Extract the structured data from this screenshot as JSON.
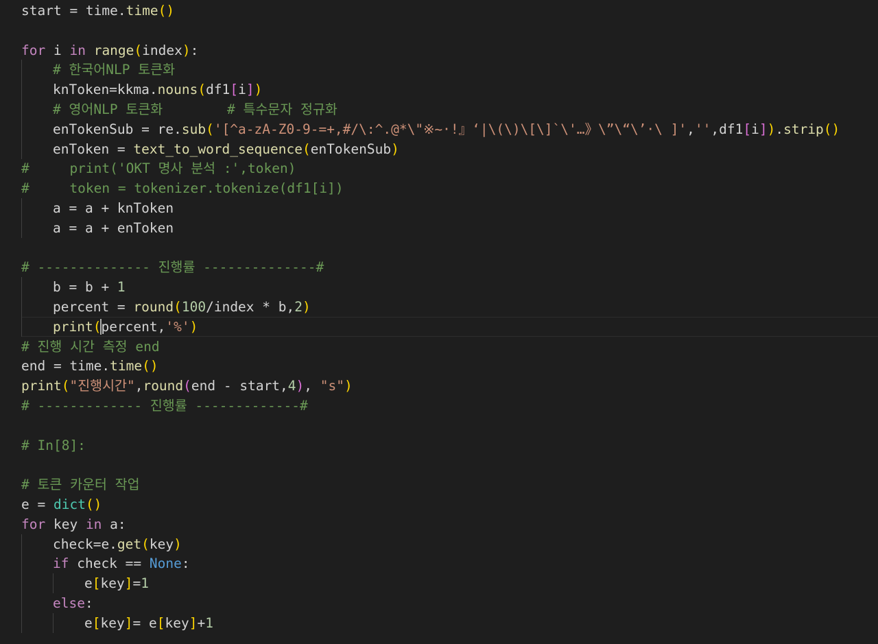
{
  "editor": {
    "theme_colors": {
      "background": "#1e1e1e",
      "keyword": "#c586c0",
      "function": "#dcdcaa",
      "string": "#ce9178",
      "number": "#b5cea8",
      "comment": "#6a9955",
      "class": "#4ec9b0",
      "constant": "#569cd6",
      "bracket_level1": "#ffd700",
      "bracket_level2": "#da70d6"
    },
    "lines": [
      {
        "indent": 0,
        "tokens": [
          [
            "id",
            "start = time."
          ],
          [
            "fn",
            "time"
          ],
          [
            "b1",
            "()"
          ]
        ]
      },
      {
        "indent": 0,
        "tokens": []
      },
      {
        "indent": 0,
        "tokens": [
          [
            "kw",
            "for"
          ],
          [
            "id",
            " i "
          ],
          [
            "kw",
            "in"
          ],
          [
            "id",
            " "
          ],
          [
            "fn",
            "range"
          ],
          [
            "b1",
            "("
          ],
          [
            "id",
            "index"
          ],
          [
            "b1",
            ")"
          ],
          [
            "id",
            ":"
          ]
        ]
      },
      {
        "indent": 1,
        "tokens": [
          [
            "cm",
            "# 한국어NLP 토큰화"
          ]
        ]
      },
      {
        "indent": 1,
        "tokens": [
          [
            "id",
            "knToken=kkma."
          ],
          [
            "fn",
            "nouns"
          ],
          [
            "b1",
            "("
          ],
          [
            "id",
            "df1"
          ],
          [
            "b2",
            "["
          ],
          [
            "id",
            "i"
          ],
          [
            "b2",
            "]"
          ],
          [
            "b1",
            ")"
          ]
        ]
      },
      {
        "indent": 1,
        "tokens": [
          [
            "cm",
            "# 영어NLP 토큰화        # 특수문자 정규화"
          ]
        ]
      },
      {
        "indent": 1,
        "tokens": [
          [
            "id",
            "enTokenSub = re."
          ],
          [
            "fn",
            "sub"
          ],
          [
            "b1",
            "("
          ],
          [
            "str",
            "'[^a-zA-Z0-9-=+,#/\\:^.@*\\\"※~·!』‘|\\(\\)\\[\\]`\\'…》\\”\\“\\’·\\ ]'"
          ],
          [
            "id",
            ","
          ],
          [
            "str",
            "''"
          ],
          [
            "id",
            ",df1"
          ],
          [
            "b2",
            "["
          ],
          [
            "id",
            "i"
          ],
          [
            "b2",
            "]"
          ],
          [
            "b1",
            ")"
          ],
          [
            "id",
            "."
          ],
          [
            "fn",
            "strip"
          ],
          [
            "b1",
            "()"
          ]
        ]
      },
      {
        "indent": 1,
        "tokens": [
          [
            "id",
            "enToken = "
          ],
          [
            "fn",
            "text_to_word_sequence"
          ],
          [
            "b1",
            "("
          ],
          [
            "id",
            "enTokenSub"
          ],
          [
            "b1",
            ")"
          ]
        ]
      },
      {
        "indent": 0,
        "tokens": [
          [
            "cm",
            "#     print('OKT 명사 분석 :',token)"
          ]
        ]
      },
      {
        "indent": 0,
        "tokens": [
          [
            "cm",
            "#     token = tokenizer.tokenize(df1[i])"
          ]
        ]
      },
      {
        "indent": 1,
        "tokens": [
          [
            "id",
            "a = a + knToken"
          ]
        ]
      },
      {
        "indent": 1,
        "tokens": [
          [
            "id",
            "a = a + enToken"
          ]
        ]
      },
      {
        "indent": 0,
        "tokens": []
      },
      {
        "indent": 0,
        "tokens": [
          [
            "cm",
            "# -------------- 진행률 --------------#"
          ]
        ]
      },
      {
        "indent": 1,
        "tokens": [
          [
            "id",
            "b = b + "
          ],
          [
            "num",
            "1"
          ]
        ]
      },
      {
        "indent": 1,
        "tokens": [
          [
            "id",
            "percent = "
          ],
          [
            "fn",
            "round"
          ],
          [
            "b1",
            "("
          ],
          [
            "num",
            "100"
          ],
          [
            "id",
            "/index * b,"
          ],
          [
            "num",
            "2"
          ],
          [
            "b1",
            ")"
          ]
        ]
      },
      {
        "indent": 1,
        "current": true,
        "tokens": [
          [
            "fn",
            "print"
          ],
          [
            "b1",
            "("
          ],
          [
            "id",
            "percent,"
          ],
          [
            "str",
            "'%'"
          ],
          [
            "b1",
            ")"
          ]
        ]
      },
      {
        "indent": 0,
        "tokens": [
          [
            "cm",
            "# 진행 시간 측정 end"
          ]
        ]
      },
      {
        "indent": 0,
        "tokens": [
          [
            "id",
            "end = time."
          ],
          [
            "fn",
            "time"
          ],
          [
            "b1",
            "()"
          ]
        ]
      },
      {
        "indent": 0,
        "tokens": [
          [
            "fn",
            "print"
          ],
          [
            "b1",
            "("
          ],
          [
            "str",
            "\"진행시간\""
          ],
          [
            "id",
            ","
          ],
          [
            "fn",
            "round"
          ],
          [
            "b2",
            "("
          ],
          [
            "id",
            "end - start,"
          ],
          [
            "num",
            "4"
          ],
          [
            "b2",
            ")"
          ],
          [
            "id",
            ", "
          ],
          [
            "str",
            "\"s\""
          ],
          [
            "b1",
            ")"
          ]
        ]
      },
      {
        "indent": 0,
        "tokens": [
          [
            "cm",
            "# ------------- 진행률 -------------#"
          ]
        ]
      },
      {
        "indent": 0,
        "tokens": []
      },
      {
        "indent": 0,
        "tokens": [
          [
            "cm",
            "# In[8]:"
          ]
        ]
      },
      {
        "indent": 0,
        "tokens": []
      },
      {
        "indent": 0,
        "tokens": [
          [
            "cm",
            "# 토큰 카운터 작업"
          ]
        ]
      },
      {
        "indent": 0,
        "tokens": [
          [
            "id",
            "e = "
          ],
          [
            "cls",
            "dict"
          ],
          [
            "b1",
            "()"
          ]
        ]
      },
      {
        "indent": 0,
        "tokens": [
          [
            "kw",
            "for"
          ],
          [
            "id",
            " key "
          ],
          [
            "kw",
            "in"
          ],
          [
            "id",
            " a:"
          ]
        ]
      },
      {
        "indent": 1,
        "tokens": [
          [
            "id",
            "check=e."
          ],
          [
            "fn",
            "get"
          ],
          [
            "b1",
            "("
          ],
          [
            "id",
            "key"
          ],
          [
            "b1",
            ")"
          ]
        ]
      },
      {
        "indent": 1,
        "tokens": [
          [
            "kw",
            "if"
          ],
          [
            "id",
            " check == "
          ],
          [
            "cst",
            "None"
          ],
          [
            "id",
            ":"
          ]
        ]
      },
      {
        "indent": 2,
        "tokens": [
          [
            "id",
            "e"
          ],
          [
            "b1",
            "["
          ],
          [
            "id",
            "key"
          ],
          [
            "b1",
            "]"
          ],
          [
            "id",
            "="
          ],
          [
            "num",
            "1"
          ]
        ]
      },
      {
        "indent": 1,
        "tokens": [
          [
            "kw",
            "else"
          ],
          [
            "id",
            ":"
          ]
        ]
      },
      {
        "indent": 2,
        "tokens": [
          [
            "id",
            "e"
          ],
          [
            "b1",
            "["
          ],
          [
            "id",
            "key"
          ],
          [
            "b1",
            "]"
          ],
          [
            "id",
            "= e"
          ],
          [
            "b1",
            "["
          ],
          [
            "id",
            "key"
          ],
          [
            "b1",
            "]"
          ],
          [
            "id",
            "+"
          ],
          [
            "num",
            "1"
          ]
        ]
      }
    ]
  }
}
